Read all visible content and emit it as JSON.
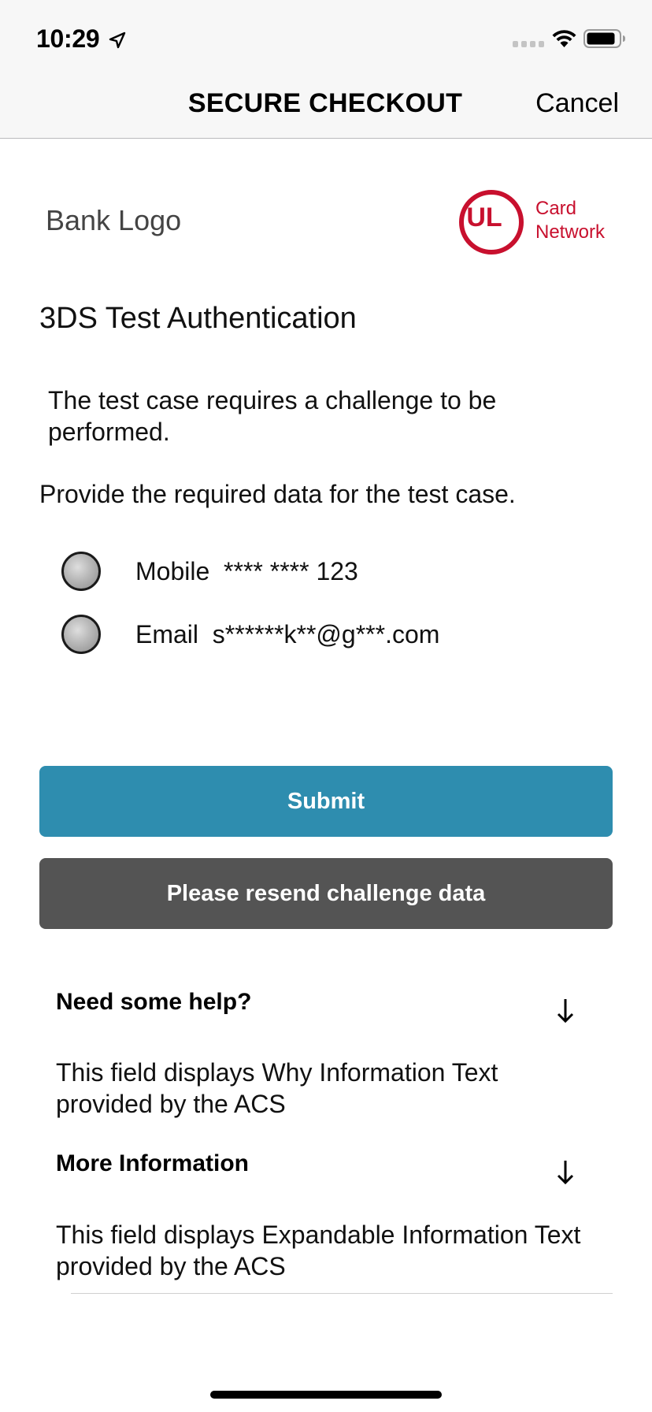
{
  "status_bar": {
    "time": "10:29"
  },
  "nav": {
    "title": "SECURE CHECKOUT",
    "cancel_label": "Cancel"
  },
  "branding": {
    "bank_logo": "Bank Logo",
    "network_logo_letters": "UL",
    "network_line1": "Card",
    "network_line2": "Network",
    "network_color": "#c8102e"
  },
  "content": {
    "heading": "3DS Test Authentication",
    "info_text": "The test case requires a challenge to be performed.",
    "prompt": "Provide the required data for the test case."
  },
  "options": [
    {
      "label": "Mobile  **** **** 123",
      "selected": false
    },
    {
      "label": "Email  s******k**@g***.com",
      "selected": false
    }
  ],
  "buttons": {
    "submit": "Submit",
    "resend": "Please resend challenge data",
    "submit_color": "#2e8daf",
    "resend_color": "#545454"
  },
  "help": {
    "title": "Need some help?",
    "body": "This field displays Why Information Text provided by the ACS",
    "icon": "arrow-down-icon"
  },
  "more_info": {
    "title": "More Information",
    "body": "This field displays Expandable Information Text provided by the ACS",
    "icon": "arrow-down-icon"
  }
}
